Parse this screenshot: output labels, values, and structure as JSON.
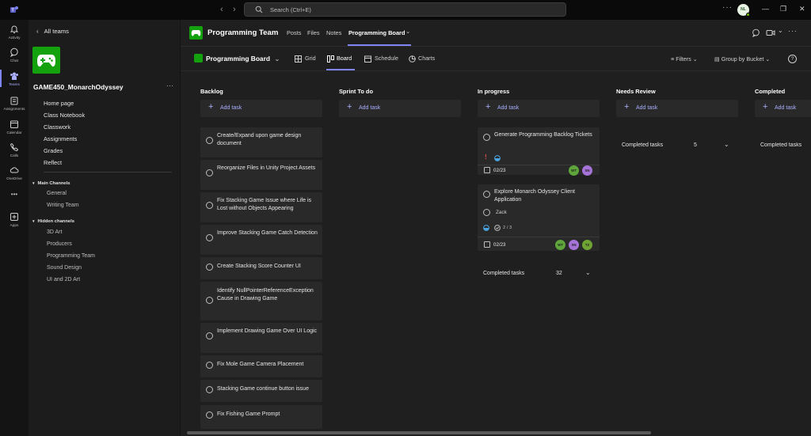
{
  "titlebar": {
    "search_placeholder": "Search (Ctrl+E)",
    "back": "‹",
    "forward": "›",
    "more": "···",
    "avatar_initials": "NL",
    "minimize": "—",
    "maximize": "❐",
    "close": "✕"
  },
  "rail": {
    "items": [
      {
        "label": "Activity",
        "icon": "bell-icon"
      },
      {
        "label": "Chat",
        "icon": "chat-icon"
      },
      {
        "label": "Teams",
        "icon": "teams-icon"
      },
      {
        "label": "Assignments",
        "icon": "assignments-icon"
      },
      {
        "label": "Calendar",
        "icon": "calendar-icon"
      },
      {
        "label": "Calls",
        "icon": "phone-icon"
      },
      {
        "label": "OneDrive",
        "icon": "cloud-icon"
      },
      {
        "label": "Apps",
        "icon": "apps-icon"
      }
    ],
    "more": "•••"
  },
  "sidebar": {
    "back_label": "All teams",
    "team_name": "GAME450_MonarchOdyssey",
    "more": "···",
    "links": [
      "Home page",
      "Class Notebook",
      "Classwork",
      "Assignments",
      "Grades",
      "Reflect"
    ],
    "main_channels_label": "Main Channels",
    "main_channels": [
      "General",
      "Writing Team"
    ],
    "hidden_channels_label": "Hidden channels",
    "hidden_channels": [
      "3D Art",
      "Producers",
      "Programming Team",
      "Sound Design",
      "UI and 2D Art"
    ]
  },
  "header": {
    "title": "Programming Team",
    "tabs": [
      "Posts",
      "Files",
      "Notes",
      "Programming Board"
    ],
    "active_tab_chevron": "⌄"
  },
  "planner": {
    "board_name": "Programming Board",
    "views": [
      "Grid",
      "Board",
      "Schedule",
      "Charts"
    ],
    "filters_label": "Filters",
    "group_by_label": "Group by Bucket",
    "help": "?"
  },
  "buckets": [
    {
      "name": "Backlog",
      "add_label": "Add task"
    },
    {
      "name": "Sprint To do",
      "add_label": "Add task"
    },
    {
      "name": "In progress",
      "add_label": "Add task"
    },
    {
      "name": "Needs Review",
      "add_label": "Add task"
    },
    {
      "name": "Completed",
      "add_label": "Add task"
    }
  ],
  "backlog_tasks": [
    "Create/Expand upon game design document",
    "Reorganize Files in Unity Project Assets",
    "Fix Stacking Game Issue where Life is Lost without Objects Appearing",
    "Improve Stacking Game Catch Detection",
    "Create Stacking Score Counter UI",
    "Identify NullPointerReferenceException Cause in Drawing Game",
    "Implement Drawing Game Over UI Logic",
    "Fix Mole Game Camera Placement",
    "Stacking Game continue button issue",
    "Fix Fishing Game Prompt"
  ],
  "in_progress_tasks": [
    {
      "title": "Generate Programming Backlog Tickets",
      "priority": "!",
      "due": "02/23",
      "assignees": [
        "WT",
        "SN"
      ]
    },
    {
      "title": "Explore Monarch Odyssey Client Application",
      "assignee_name": "Zack",
      "checklist": "2 / 3",
      "due": "02/23",
      "assignees": [
        "WT",
        "SN",
        "TZ"
      ]
    }
  ],
  "completed_sections": {
    "in_progress": {
      "label": "Completed tasks",
      "count": "32"
    },
    "needs_review": {
      "label": "Completed tasks",
      "count": "5"
    },
    "completed": {
      "label": "Completed tasks"
    }
  }
}
